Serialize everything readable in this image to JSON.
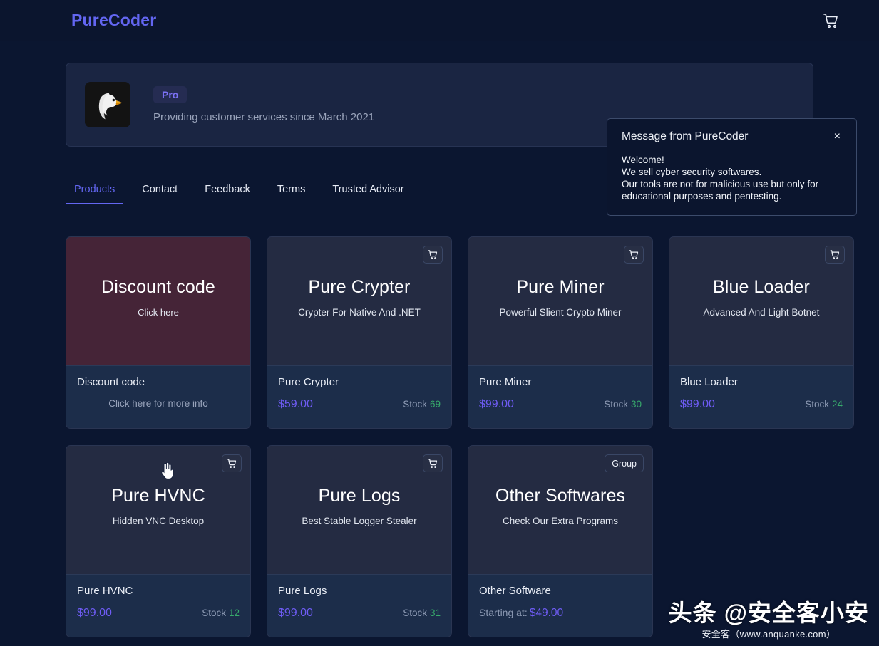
{
  "header": {
    "brand": "PureCoder",
    "cart_icon": "shopping-cart-icon"
  },
  "profile": {
    "avatar_icon": "eagle-avatar",
    "badge": "Pro",
    "subtitle": "Providing customer services since March 2021"
  },
  "message_popup": {
    "title": "Message from PureCoder",
    "close_label": "×",
    "body_lines": [
      "Welcome!",
      "We sell cyber security softwares.",
      "Our tools are not for malicious use but only for educational purposes and pentesting."
    ],
    "body": "Welcome!\nWe sell cyber security softwares.\nOur tools are not for malicious use but only for educational purposes and pentesting."
  },
  "tabs": [
    {
      "label": "Products",
      "active": true
    },
    {
      "label": "Contact",
      "active": false
    },
    {
      "label": "Feedback",
      "active": false
    },
    {
      "label": "Terms",
      "active": false
    },
    {
      "label": "Trusted Advisor",
      "active": false
    }
  ],
  "products": [
    {
      "title": "Discount code",
      "subtitle": "Click here",
      "name": "Discount code",
      "note": "Click here for more info",
      "kind": "discount",
      "corner": "none"
    },
    {
      "title": "Pure Crypter",
      "subtitle": "Crypter For Native And .NET",
      "name": "Pure Crypter",
      "price": "$59.00",
      "stock_label": "Stock",
      "stock_value": "69",
      "kind": "product",
      "corner": "cart"
    },
    {
      "title": "Pure Miner",
      "subtitle": "Powerful Slient Crypto Miner",
      "name": "Pure Miner",
      "price": "$99.00",
      "stock_label": "Stock",
      "stock_value": "30",
      "kind": "product",
      "corner": "cart"
    },
    {
      "title": "Blue Loader",
      "subtitle": "Advanced And Light Botnet",
      "name": "Blue Loader",
      "price": "$99.00",
      "stock_label": "Stock",
      "stock_value": "24",
      "kind": "product",
      "corner": "cart"
    },
    {
      "title": "Pure HVNC",
      "subtitle": "Hidden VNC Desktop",
      "name": "Pure HVNC",
      "price": "$99.00",
      "stock_label": "Stock",
      "stock_value": "12",
      "kind": "product",
      "corner": "cart"
    },
    {
      "title": "Pure Logs",
      "subtitle": "Best Stable Logger Stealer",
      "name": "Pure Logs",
      "price": "$99.00",
      "stock_label": "Stock",
      "stock_value": "31",
      "kind": "product",
      "corner": "cart"
    },
    {
      "title": "Other Softwares",
      "subtitle": "Check Our Extra Programs",
      "name": "Other Software",
      "starting_label": "Starting at:",
      "price": "$49.00",
      "kind": "group",
      "corner": "group",
      "corner_label": "Group"
    }
  ],
  "watermark": {
    "main": "头条 @安全客小安",
    "sub": "安全客（www.anquanke.com）"
  },
  "colors": {
    "page_bg": "#0b1630",
    "panel_bg": "#1a2542",
    "card_top": "#242b42",
    "card_bottom": "#1c2d4a",
    "discount_top": "#452437",
    "accent_purple": "#6366f1",
    "price_purple": "#6f5cf5",
    "stock_green": "#37a96b",
    "muted_text": "#9aa4bb"
  },
  "cursor": {
    "type": "pointer-hand-cursor"
  }
}
